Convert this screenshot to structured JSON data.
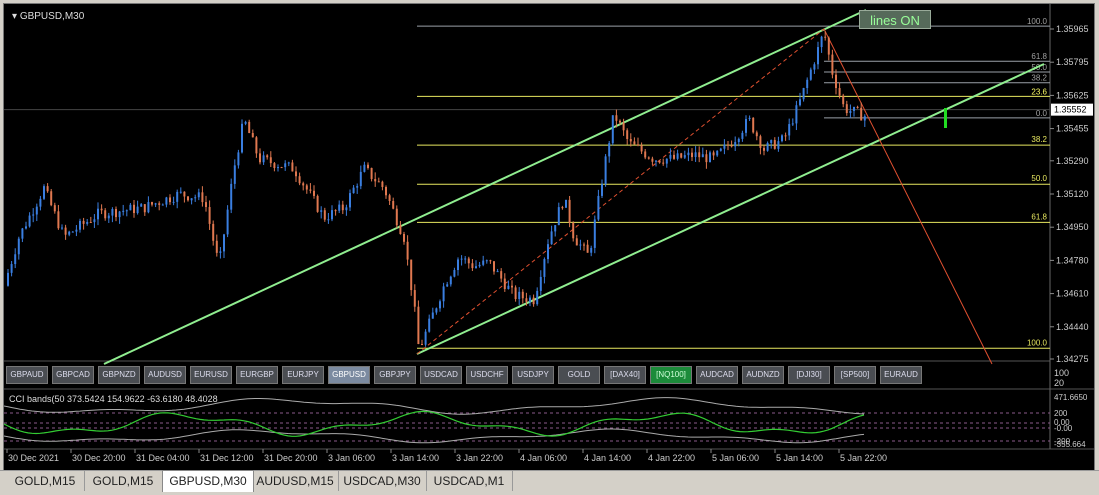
{
  "chart_title": "GBPUSD,M30",
  "lines_button": "lines ON",
  "price_axis": [
    "1.35965",
    "1.35795",
    "1.35625",
    "1.35455",
    "1.35290",
    "1.35120",
    "1.34950",
    "1.34780",
    "1.34610",
    "1.34440",
    "1.34275"
  ],
  "current_price": "1.35552",
  "fib_right": [
    {
      "label": "100.0",
      "price": 1.3598,
      "color": "#a0a0a0"
    },
    {
      "label": "61.8",
      "price": 1.358,
      "color": "#a0a0a0"
    },
    {
      "label": "50.0",
      "price": 1.35745,
      "color": "#a0a0a0"
    },
    {
      "label": "38.2",
      "price": 1.3569,
      "color": "#a0a0a0"
    },
    {
      "label": "23.6",
      "price": 1.3562,
      "color": "#ffff66"
    },
    {
      "label": "0.0",
      "price": 1.3551,
      "color": "#a0a0a0"
    }
  ],
  "fib_main": [
    {
      "label": "38.2",
      "price": 1.3537
    },
    {
      "label": "50.0",
      "price": 1.3517
    },
    {
      "label": "61.8",
      "price": 1.34975
    },
    {
      "label": "100.0",
      "price": 1.3433
    }
  ],
  "symbol_buttons": [
    "GBPAUD",
    "GBPCAD",
    "GBPNZD",
    "AUDUSD",
    "EURUSD",
    "EURGBP",
    "EURJPY",
    "GBPUSD",
    "GBPJPY",
    "USDCAD",
    "USDCHF",
    "USDJPY",
    "GOLD",
    "[DAX40]",
    "[NQ100]",
    "AUDCAD",
    "AUDNZD",
    "[DJI30]",
    "[SP500]",
    "EURAUD"
  ],
  "active_symbol": "GBPUSD",
  "highlight_symbol": "[NQ100]",
  "indicator_label": "CCI bands(50 373.5424 154.9622 -63.6180 48.4028",
  "upper_pane_axis": [
    "100",
    "20"
  ],
  "indicator_axis": [
    "471.6650",
    "200",
    "0.00",
    "-0.00",
    "-200",
    "-355.664"
  ],
  "time_axis": [
    "30 Dec 2021",
    "30 Dec 20:00",
    "31 Dec 04:00",
    "31 Dec 12:00",
    "31 Dec 20:00",
    "3 Jan 06:00",
    "3 Jan 14:00",
    "3 Jan 22:00",
    "4 Jan 06:00",
    "4 Jan 14:00",
    "4 Jan 22:00",
    "5 Jan 06:00",
    "5 Jan 14:00",
    "5 Jan 22:00"
  ],
  "tabs": [
    "GOLD,M15",
    "GOLD,M15",
    "GBPUSD,M30",
    "AUDUSD,M15",
    "USDCAD,M30",
    "USDCAD,M1"
  ],
  "active_tab": "GBPUSD,M30",
  "colors": {
    "bull": "#3a7ee0",
    "bear": "#e07850",
    "channel": "#90ee90",
    "fib": "#e8e860",
    "fib_minor": "#9aa0a8",
    "trend": "#e05030"
  }
}
